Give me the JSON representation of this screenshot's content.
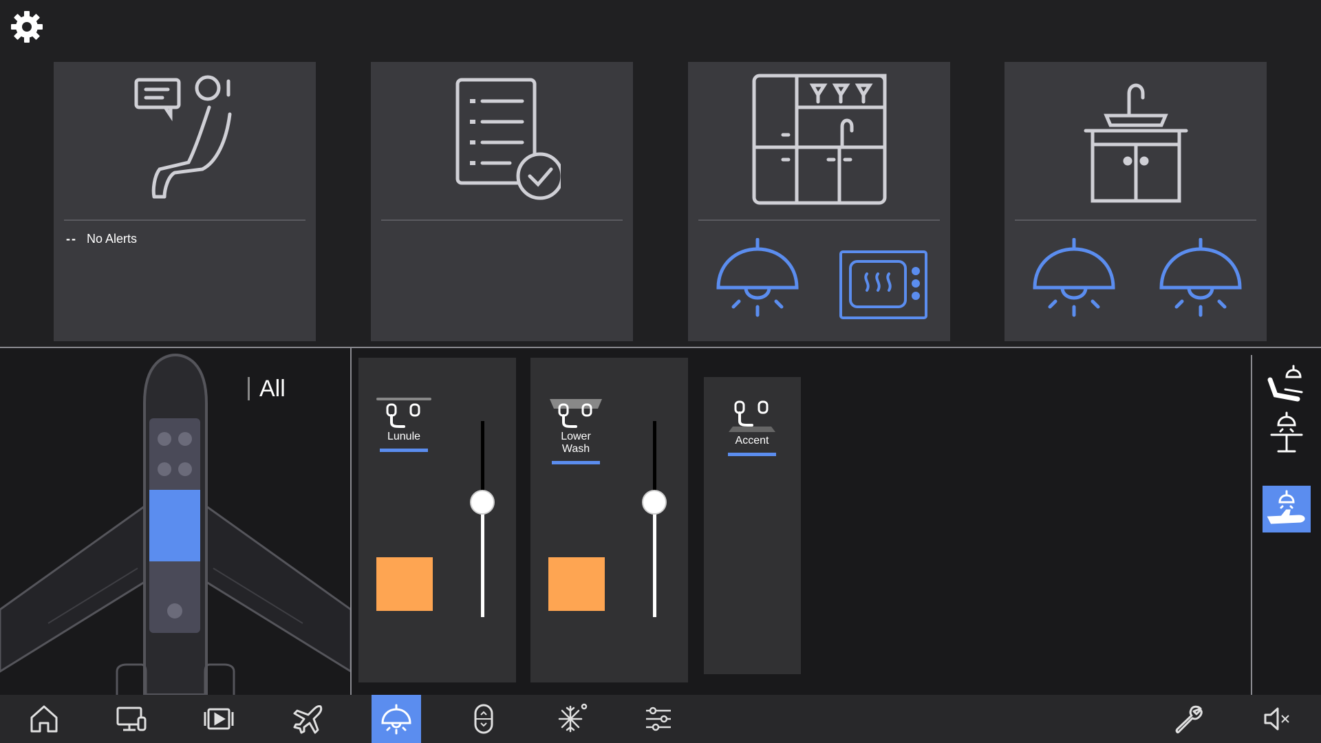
{
  "colors": {
    "accent": "#5b8def",
    "swatch": "#fea552",
    "card_bg": "#3a3a3e",
    "background": "#1c1c1e"
  },
  "header": {
    "settings_icon": "gear-icon"
  },
  "cards": [
    {
      "icon": "passenger-call-icon",
      "alerts_dash": "--",
      "alerts_text": "No Alerts"
    },
    {
      "icon": "checklist-icon"
    },
    {
      "icon": "galley-icon",
      "buttons": [
        "galley-light-icon",
        "oven-icon"
      ]
    },
    {
      "icon": "lavatory-icon",
      "buttons": [
        "lavatory-light-icon",
        "lavatory-light-icon"
      ]
    }
  ],
  "zone": {
    "label": "All"
  },
  "lights": [
    {
      "label": "Lunule",
      "level": 0.6,
      "color": "#fea552"
    },
    {
      "label": "Lower Wash",
      "level": 0.6,
      "color": "#fea552"
    },
    {
      "label": "Accent"
    }
  ],
  "modes": [
    "seat-light-icon",
    "table-light-icon",
    "cabin-light-icon"
  ],
  "nav": {
    "items": [
      "home-icon",
      "monitor-icon",
      "media-icon",
      "flight-icon",
      "lighting-icon",
      "window-shade-icon",
      "climate-icon",
      "settings-sliders-icon"
    ],
    "active": "lighting-icon",
    "right": [
      "wrench-icon",
      "mute-icon"
    ]
  }
}
